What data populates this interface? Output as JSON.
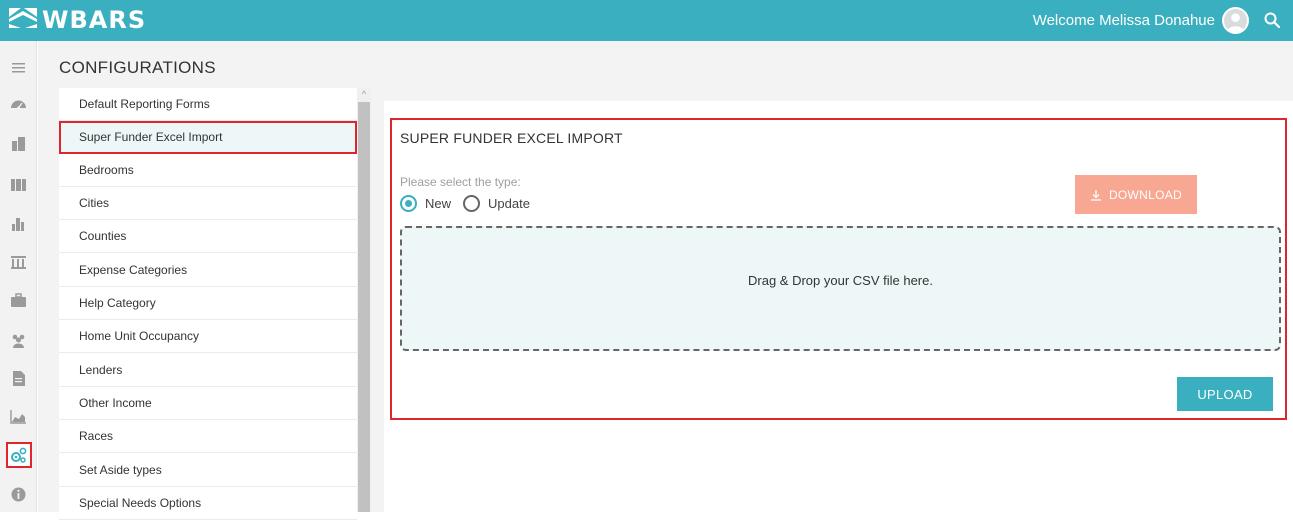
{
  "app": {
    "brand": "WBARS",
    "welcome": "Welcome Melissa Donahue",
    "accent_color": "#3aafbf",
    "highlight_color": "#e0252d"
  },
  "rail": {
    "icons": [
      "menu-icon",
      "dashboard-icon",
      "buildings-icon",
      "city-icon",
      "chart-building-icon",
      "institution-icon",
      "briefcase-icon",
      "users-icon",
      "document-icon",
      "area-chart-icon",
      "configurations-icon",
      "info-icon"
    ],
    "active": "configurations-icon"
  },
  "header": {
    "title": "CONFIGURATIONS"
  },
  "sidebar": {
    "items": [
      {
        "label": "Default Reporting Forms"
      },
      {
        "label": "Super Funder Excel Import"
      },
      {
        "label": "Bedrooms"
      },
      {
        "label": "Cities"
      },
      {
        "label": "Counties"
      },
      {
        "label": "Expense Categories"
      },
      {
        "label": "Help Category"
      },
      {
        "label": "Home Unit Occupancy"
      },
      {
        "label": "Lenders"
      },
      {
        "label": "Other Income"
      },
      {
        "label": "Races"
      },
      {
        "label": "Set Aside types"
      },
      {
        "label": "Special Needs Options"
      }
    ],
    "selected": "Super Funder Excel Import"
  },
  "import": {
    "title": "SUPER FUNDER EXCEL IMPORT",
    "type_prompt": "Please select the type:",
    "options": [
      {
        "label": "New",
        "checked": true
      },
      {
        "label": "Update",
        "checked": false
      }
    ],
    "download_label": "DOWNLOAD",
    "drop_text": "Drag & Drop your CSV file here.",
    "upload_label": "UPLOAD"
  }
}
